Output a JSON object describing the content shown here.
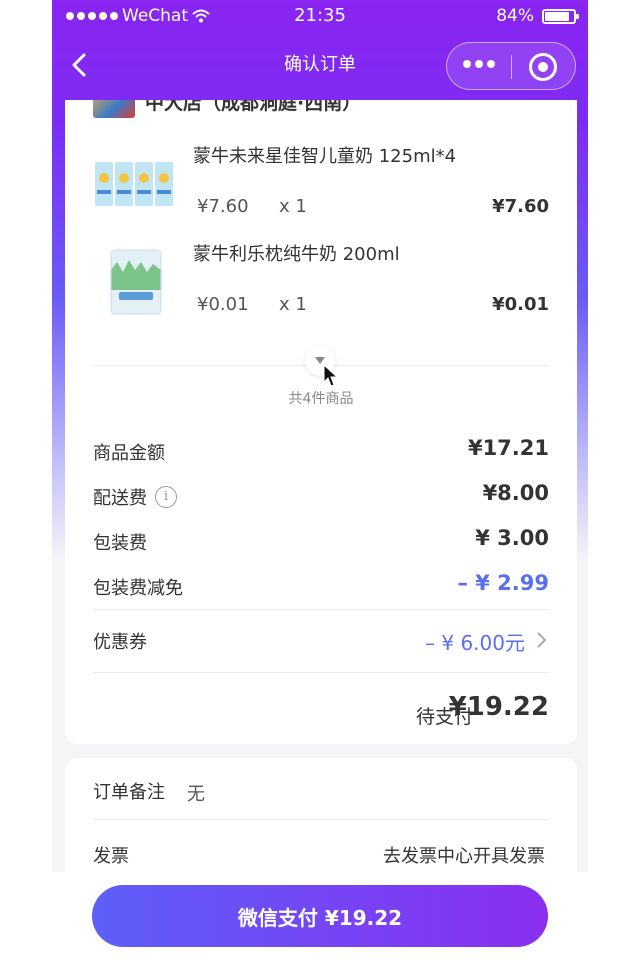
{
  "status_bar": {
    "carrier": "WeChat",
    "time": "21:35",
    "battery": "84%"
  },
  "nav": {
    "title": "确认订单"
  },
  "shop": {
    "name": "中大店（成都洞庭·西南）"
  },
  "items": [
    {
      "name": "蒙牛未来星佳智儿童奶 125ml*4",
      "unit_price": "¥7.60",
      "quantity": "x 1",
      "total": "¥7.60"
    },
    {
      "name": "蒙牛利乐枕纯牛奶 200ml",
      "unit_price": "¥0.01",
      "quantity": "x 1",
      "total": "¥0.01"
    }
  ],
  "item_count_text": "共4件商品",
  "fees": {
    "goods_amount_label": "商品金额",
    "goods_amount_value": "¥17.21",
    "delivery_label": "配送费",
    "delivery_value": "¥8.00",
    "packing_label": "包装费",
    "packing_value": "¥ 3.00",
    "packing_discount_label": "包装费减免",
    "packing_discount_value": "– ¥ 2.99",
    "coupon_label": "优惠券",
    "coupon_value": "– ¥ 6.00元"
  },
  "pending": {
    "label": "待支付",
    "value": "¥19.22"
  },
  "note": {
    "label": "订单备注",
    "value": "无"
  },
  "invoice": {
    "label": "发票",
    "link": "去发票中心开具发票"
  },
  "pay_button": "微信支付 ¥19.22",
  "colors": {
    "header_gradient_top": "#8a24f0",
    "accent_blue": "#5a6ff0",
    "pay_gradient_start": "#5d5ff8",
    "pay_gradient_end": "#8a2ef0"
  }
}
